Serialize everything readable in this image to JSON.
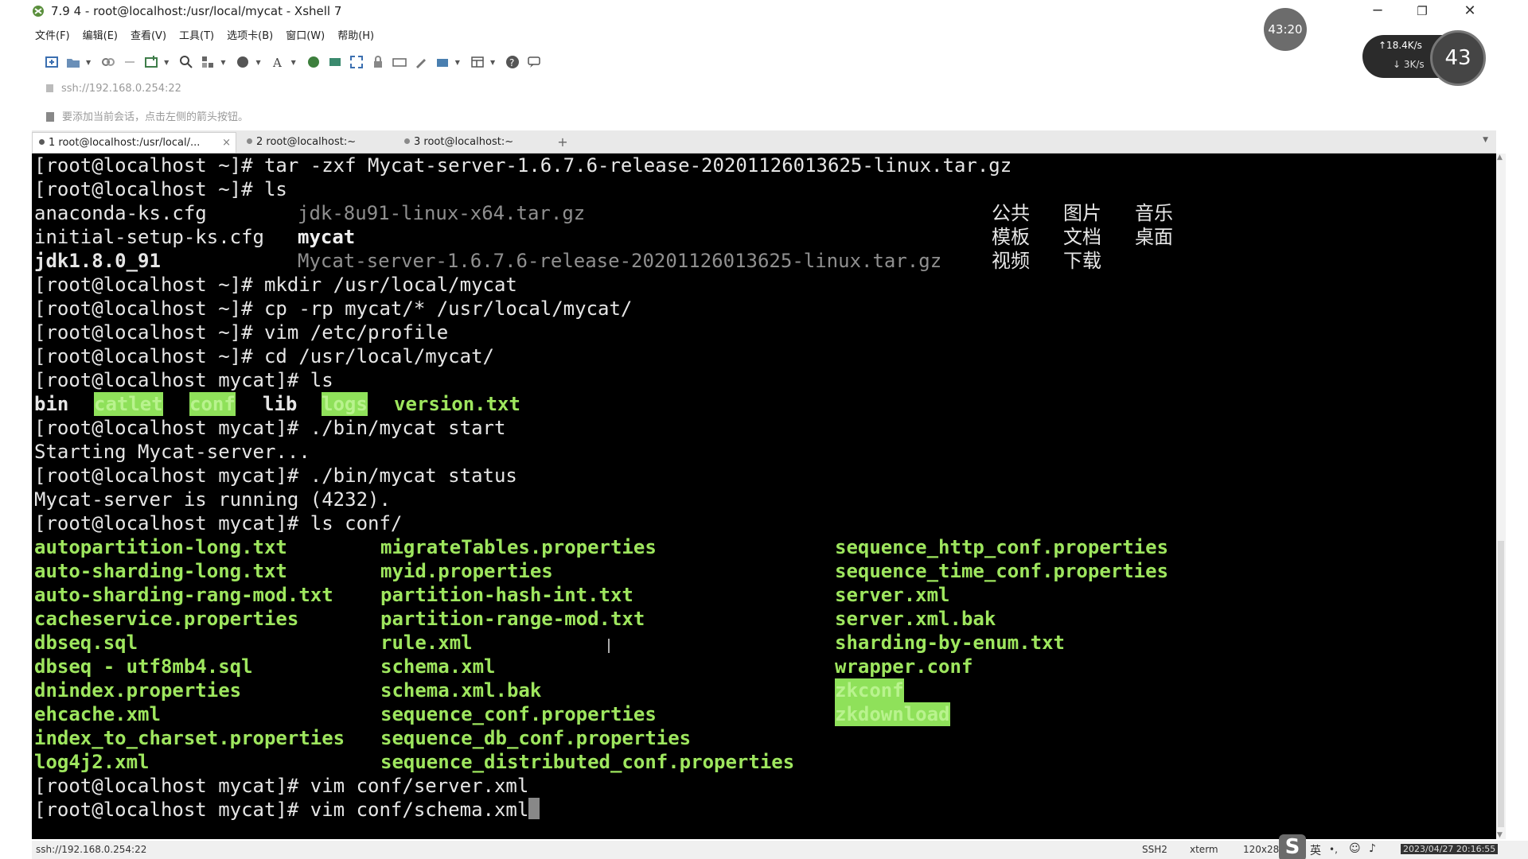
{
  "window": {
    "title": "7.9 4 - root@localhost:/usr/local/mycat - Xshell 7",
    "minimize": "─",
    "maximize": "❐",
    "close": "✕"
  },
  "menu": [
    "文件(F)",
    "编辑(E)",
    "查看(V)",
    "工具(T)",
    "选项卡(B)",
    "窗口(W)",
    "帮助(H)"
  ],
  "address": "ssh://192.168.0.254:22",
  "hint": "要添加当前会话，点击左侧的箭头按钮。",
  "tabs": [
    {
      "label": "1 root@localhost:/usr/local/...",
      "close": "×"
    },
    {
      "label": "2 root@localhost:~",
      "close": ""
    },
    {
      "label": "3 root@localhost:~",
      "close": ""
    }
  ],
  "new_tab": "+",
  "terminal": {
    "line1": "[root@localhost ~]# tar -zxf Mycat-server-1.6.7.6-release-20201126013625-linux.tar.gz",
    "line2": "[root@localhost ~]# ls",
    "ls_home": {
      "col1": [
        "anaconda-ks.cfg",
        "initial-setup-ks.cfg",
        "jdk1.8.0_91"
      ],
      "col2": [
        "jdk-8u91-linux-x64.tar.gz",
        "mycat",
        "Mycat-server-1.6.7.6-release-20201126013625-linux.tar.gz"
      ],
      "col3": [
        "公共",
        "模板",
        "视频"
      ],
      "col4": [
        "图片",
        "文档",
        "下载"
      ],
      "col5": [
        "音乐",
        "桌面"
      ]
    },
    "line6": "[root@localhost ~]# mkdir /usr/local/mycat",
    "line7": "[root@localhost ~]# cp -rp mycat/* /usr/local/mycat/",
    "line8": "[root@localhost ~]# vim /etc/profile",
    "line9": "[root@localhost ~]# cd /usr/local/mycat/",
    "line10": "[root@localhost mycat]# ls",
    "ls_mycat": [
      "bin",
      "catlet",
      "conf",
      "lib",
      "logs",
      "version.txt"
    ],
    "line12": "[root@localhost mycat]# ./bin/mycat start",
    "line13": "Starting Mycat-server...",
    "line14": "[root@localhost mycat]# ./bin/mycat status",
    "line15": "Mycat-server is running (4232).",
    "line16": "[root@localhost mycat]# ls conf/",
    "conf_col1": [
      "autopartition-long.txt",
      "auto-sharding-long.txt",
      "auto-sharding-rang-mod.txt",
      "cacheservice.properties",
      "dbseq.sql",
      "dbseq - utf8mb4.sql",
      "dnindex.properties",
      "ehcache.xml",
      "index_to_charset.properties",
      "log4j2.xml"
    ],
    "conf_col2": [
      "migrateTables.properties",
      "myid.properties",
      "partition-hash-int.txt",
      "partition-range-mod.txt",
      "rule.xml",
      "schema.xml",
      "schema.xml.bak",
      "sequence_conf.properties",
      "sequence_db_conf.properties",
      "sequence_distributed_conf.properties"
    ],
    "conf_col3": [
      "sequence_http_conf.properties",
      "sequence_time_conf.properties",
      "server.xml",
      "server.xml.bak",
      "sharding-by-enum.txt",
      "wrapper.conf",
      "zkconf",
      "zkdownload"
    ],
    "line27": "[root@localhost mycat]# vim conf/server.xml",
    "line28": "[root@localhost mycat]# vim conf/schema.xml"
  },
  "status": {
    "address": "ssh://192.168.0.254:22",
    "protocol": "SSH2",
    "term": "xterm",
    "size": "120x28",
    "ime": "英",
    "datetime": "2023/04/27 20:16:55"
  },
  "overlay": {
    "timer": "43:20",
    "net_up": "↑18.4K/s",
    "net_down": "↓ 3K/s",
    "percent": "43"
  }
}
